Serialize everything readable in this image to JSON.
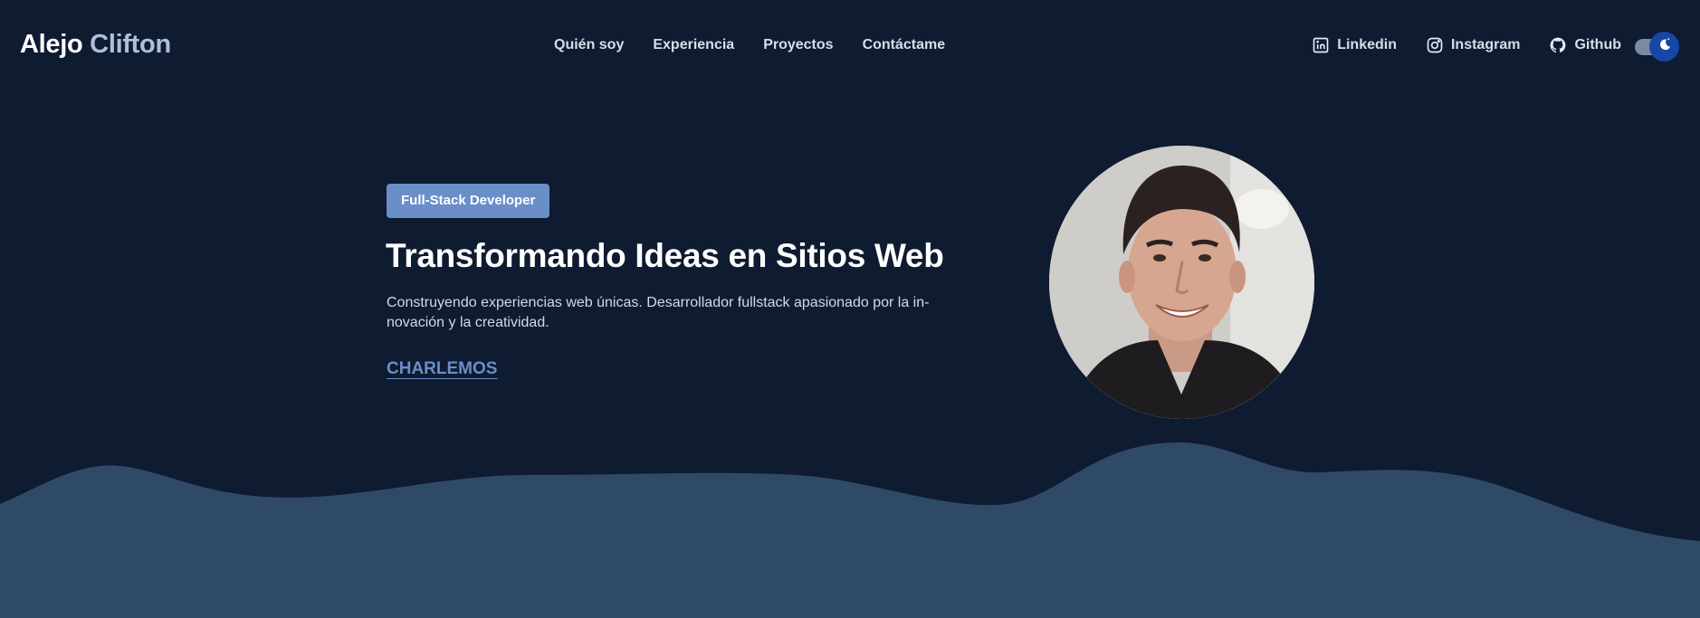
{
  "header": {
    "logo_first": "Alejo",
    "logo_last": "Clifton",
    "nav": [
      {
        "label": "Quién soy"
      },
      {
        "label": "Experiencia"
      },
      {
        "label": "Proyectos"
      },
      {
        "label": "Contáctame"
      }
    ],
    "social": [
      {
        "label": "Linkedin",
        "icon": "linkedin-icon"
      },
      {
        "label": "Instagram",
        "icon": "instagram-icon"
      },
      {
        "label": "Github",
        "icon": "github-icon"
      }
    ],
    "theme_toggle": {
      "icon": "moon-icon",
      "state": "dark"
    }
  },
  "hero": {
    "badge": "Full-Stack Developer",
    "title": "Transformando Ideas en Sitios Web",
    "subtitle": "Construyendo experiencias web únicas. Desarrollador fullstack apasionado por la in­novación y la creatividad.",
    "cta": "CHARLEMOS"
  },
  "colors": {
    "background": "#0f1b31",
    "wave": "#2f4a67",
    "accent": "#6a8ec8",
    "toggle_knob": "#1747a6"
  }
}
